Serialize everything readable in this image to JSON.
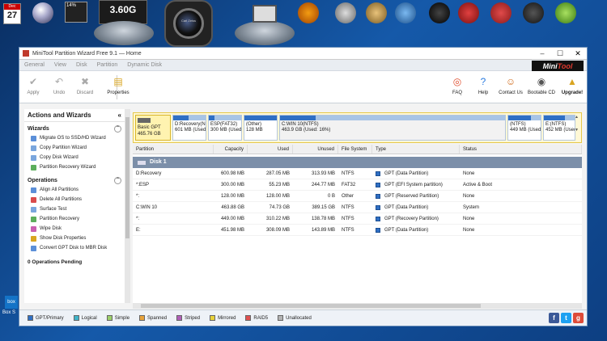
{
  "desktop": {
    "calendar": {
      "month": "Dec",
      "day": "27"
    },
    "cpu_meter": "14%",
    "memory_gauge": "3.60G",
    "camera_lens_text": "Carl Zeiss",
    "box_sync_label": "Box S"
  },
  "window": {
    "title": "MiniTool Partition Wizard Free 9.1 — Home",
    "brand_a": "Mini",
    "brand_b": "Tool",
    "menu": [
      "General",
      "View",
      "Disk",
      "Partition",
      "Dynamic Disk"
    ],
    "toolbar_left": [
      {
        "label": "Apply",
        "icon": "check-icon"
      },
      {
        "label": "Undo",
        "icon": "undo-icon"
      },
      {
        "label": "Discard",
        "icon": "discard-icon"
      },
      {
        "label": "Properties",
        "icon": "properties-icon"
      }
    ],
    "toolbar_right": [
      {
        "label": "FAQ",
        "icon": "lifebuoy-icon"
      },
      {
        "label": "Help",
        "icon": "help-icon"
      },
      {
        "label": "Contact Us",
        "icon": "contact-icon"
      },
      {
        "label": "Bootable CD",
        "icon": "cd-icon"
      },
      {
        "label": "Upgrade!",
        "icon": "upgrade-icon"
      }
    ]
  },
  "sidebar": {
    "heading": "Actions and Wizards",
    "wizards_title": "Wizards",
    "wizards": [
      "Migrate OS to SSD/HD Wizard",
      "Copy Partition Wizard",
      "Copy Disk Wizard",
      "Partition Recovery Wizard"
    ],
    "operations_title": "Operations",
    "operations": [
      "Align All Partitions",
      "Delete All Partitions",
      "Surface Test",
      "Partition Recovery",
      "Wipe Disk",
      "Show Disk Properties",
      "Convert GPT Disk to MBR Disk"
    ],
    "pending": "0 Operations Pending"
  },
  "disk_map": {
    "disk_label": "Basic GPT",
    "disk_size": "465.76 GB",
    "partitions": [
      {
        "name": "D:Recovery(N",
        "detail": "601 MB (Used:",
        "used_fraction": 0.48
      },
      {
        "name": "ESP(FAT32)",
        "detail": "300 MB (Used:",
        "used_fraction": 0.18
      },
      {
        "name": "(Other)",
        "detail": "128 MB",
        "used_fraction": 1.0
      },
      {
        "name": "C:WIN 10(NTFS)",
        "detail": "463.9 GB (Used: 16%)",
        "used_fraction": 0.16
      },
      {
        "name": "(NTFS)",
        "detail": "449 MB (Used:",
        "used_fraction": 0.69
      },
      {
        "name": "E:(NTFS)",
        "detail": "452 MB (Used:",
        "used_fraction": 0.68
      }
    ]
  },
  "table": {
    "columns": [
      "Partition",
      "Capacity",
      "Used",
      "Unused",
      "File System",
      "Type",
      "Status"
    ],
    "disk_row": "Disk 1",
    "rows": [
      [
        "D:Recovery",
        "600.98 MB",
        "287.05 MB",
        "313.93 MB",
        "NTFS",
        "GPT (Data Partition)",
        "None"
      ],
      [
        "*:ESP",
        "300.00 MB",
        "55.23 MB",
        "244.77 MB",
        "FAT32",
        "GPT (EFI System partition)",
        "Active & Boot"
      ],
      [
        "*:",
        "128.00 MB",
        "128.00 MB",
        "0 B",
        "Other",
        "GPT (Reserved Partition)",
        "None"
      ],
      [
        "C:WIN 10",
        "463.88 GB",
        "74.73 GB",
        "389.15 GB",
        "NTFS",
        "GPT (Data Partition)",
        "System"
      ],
      [
        "*:",
        "449.00 MB",
        "310.22 MB",
        "138.78 MB",
        "NTFS",
        "GPT (Recovery Partition)",
        "None"
      ],
      [
        "E:",
        "451.98 MB",
        "308.09 MB",
        "143.89 MB",
        "NTFS",
        "GPT (Data Partition)",
        "None"
      ]
    ]
  },
  "legend": [
    {
      "label": "GPT/Primary",
      "color": "#2f6fc4"
    },
    {
      "label": "Logical",
      "color": "#3fb3c8"
    },
    {
      "label": "Simple",
      "color": "#9ccf6a"
    },
    {
      "label": "Spanned",
      "color": "#e8a33a"
    },
    {
      "label": "Striped",
      "color": "#b05fb8"
    },
    {
      "label": "Mirrored",
      "color": "#e8d23a"
    },
    {
      "label": "RAID5",
      "color": "#e05050"
    },
    {
      "label": "Unallocated",
      "color": "#b3b3b3"
    }
  ],
  "colors": {
    "accent": "#2f6fc4",
    "disk_row": "#7c8fa9",
    "brand_red": "#e03a2f"
  }
}
